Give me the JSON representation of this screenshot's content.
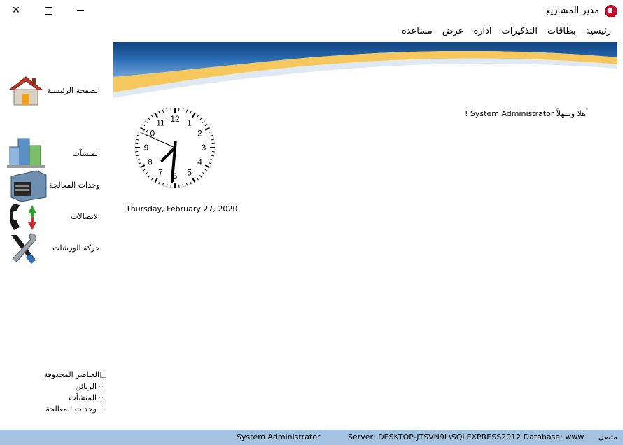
{
  "window": {
    "title": "مدير المشاريع",
    "controls": {
      "close": "✕",
      "maximize": "☐",
      "minimize": "—"
    }
  },
  "menu": {
    "items": [
      "رئيسية",
      "بطاقات",
      "التذكيرات",
      "ادارة",
      "عرض",
      "مساعدة"
    ]
  },
  "sidebar": {
    "items": [
      {
        "label": "الصفحة الرئيسية",
        "icon": "home-icon"
      },
      {
        "label": "المنشآت",
        "icon": "buildings-icon"
      },
      {
        "label": "وحدات المعالجة",
        "icon": "processing-unit-icon"
      },
      {
        "label": "الاتصالات",
        "icon": "phone-icon"
      },
      {
        "label": "حركة الورشات",
        "icon": "tools-icon"
      }
    ]
  },
  "main": {
    "greeting": "أهلا وسهلاً System Administrator !",
    "date": "Thursday, February 27, 2020",
    "clock": {
      "numerals": [
        "12",
        "1",
        "2",
        "3",
        "4",
        "5",
        "6",
        "7",
        "8",
        "9",
        "10",
        "11"
      ],
      "hour": 7,
      "minute": 30,
      "second": 49
    }
  },
  "tree": {
    "root": "العناصر المحذوفة",
    "toggle": "−",
    "children": [
      "الزبائن",
      "المنشآت",
      "وحدات المعالجة"
    ]
  },
  "status": {
    "state": "متصل",
    "server": "Server: DESKTOP-JTSVN9L\\SQLEXPRESS2012  Database: www",
    "user": "System Administrator"
  },
  "colors": {
    "statusbar": "#a4c3e0",
    "banner_blue": "#1f5ea8",
    "banner_yellow": "#f5c75c"
  }
}
